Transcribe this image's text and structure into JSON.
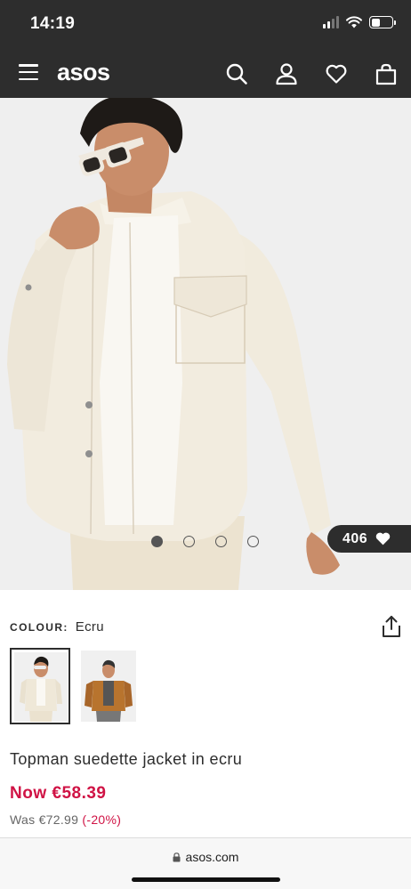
{
  "status_bar": {
    "time": "14:19",
    "battery_level_fraction": 0.45
  },
  "header": {
    "logo": "asos",
    "icons": [
      "menu-icon",
      "search-icon",
      "account-icon",
      "heart-icon",
      "bag-icon"
    ]
  },
  "gallery": {
    "image_count": 4,
    "active_index": 0,
    "saved_count": "406"
  },
  "product": {
    "colour_label": "COLOUR:",
    "colour_value": "Ecru",
    "swatches": [
      {
        "name": "Ecru",
        "selected": true
      },
      {
        "name": "Tan",
        "selected": false
      }
    ],
    "title": "Topman suedette jacket in ecru",
    "price_now": "Now €58.39",
    "price_was": "Was €72.99",
    "discount": "(-20%)"
  },
  "browser": {
    "url": "asos.com"
  },
  "colors": {
    "header_bg": "#2d2d2d",
    "sale_red": "#d01345",
    "jacket_ecru": "#efe8d8",
    "jacket_tan": "#b8742e"
  }
}
